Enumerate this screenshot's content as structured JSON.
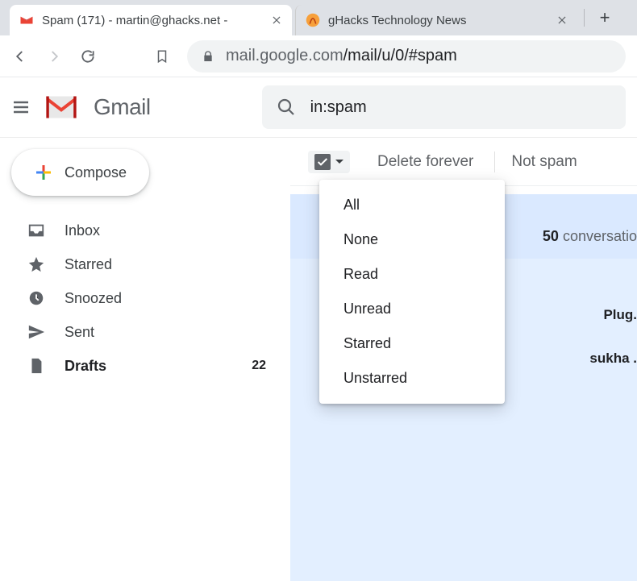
{
  "browser": {
    "tabs": [
      {
        "title": "Spam (171) - martin@ghacks.net -",
        "active": true,
        "favicon": "gmail-icon"
      },
      {
        "title": "gHacks Technology News",
        "active": false,
        "favicon": "ghacks-icon"
      }
    ],
    "url_host": "mail.google.com",
    "url_path": "/mail/u/0/#spam"
  },
  "gmail": {
    "brand": "Gmail",
    "search_value": "in:spam",
    "compose_label": "Compose",
    "sidebar": [
      {
        "icon": "inbox-icon",
        "label": "Inbox"
      },
      {
        "icon": "star-icon",
        "label": "Starred"
      },
      {
        "icon": "clock-icon",
        "label": "Snoozed"
      },
      {
        "icon": "send-icon",
        "label": "Sent"
      },
      {
        "icon": "file-icon",
        "label": "Drafts",
        "count": "22",
        "bold": true
      }
    ],
    "toolbar": {
      "delete_forever": "Delete forever",
      "not_spam": "Not spam"
    },
    "pagination": {
      "page_size": "50",
      "word": "conversatio"
    },
    "dropdown": [
      "All",
      "None",
      "Read",
      "Unread",
      "Starred",
      "Unstarred"
    ],
    "peek_rows": [
      "Plug.",
      "sukha ."
    ]
  }
}
